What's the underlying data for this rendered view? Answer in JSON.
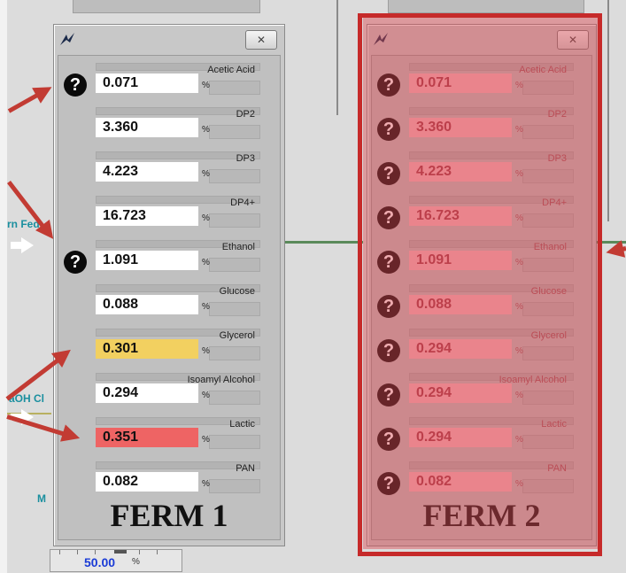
{
  "side_labels": {
    "feed": "rn Fed",
    "naoh": "aOH Cl",
    "m": "M"
  },
  "slider": {
    "value": "50.00",
    "unit": "%"
  },
  "ferm1": {
    "title": "FERM 1",
    "close_label": "✕",
    "rows": [
      {
        "label": "Acetic Acid",
        "value": "0.071",
        "unit": "%",
        "help": "?"
      },
      {
        "label": "DP2",
        "value": "3.360",
        "unit": "%"
      },
      {
        "label": "DP3",
        "value": "4.223",
        "unit": "%"
      },
      {
        "label": "DP4+",
        "value": "16.723",
        "unit": "%"
      },
      {
        "label": "Ethanol",
        "value": "1.091",
        "unit": "%",
        "help": "?"
      },
      {
        "label": "Glucose",
        "value": "0.088",
        "unit": "%"
      },
      {
        "label": "Glycerol",
        "value": "0.301",
        "unit": "%",
        "highlight": "#f2d060"
      },
      {
        "label": "Isoamyl Alcohol",
        "value": "0.294",
        "unit": "%"
      },
      {
        "label": "Lactic",
        "value": "0.351",
        "unit": "%",
        "highlight": "#ee6464"
      },
      {
        "label": "PAN",
        "value": "0.082",
        "unit": "%"
      }
    ]
  },
  "ferm2": {
    "title": "FERM 2",
    "close_label": "✕",
    "rows": [
      {
        "label": "Acetic Acid",
        "value": "0.071",
        "unit": "%",
        "help": "?"
      },
      {
        "label": "DP2",
        "value": "3.360",
        "unit": "%",
        "help": "?"
      },
      {
        "label": "DP3",
        "value": "4.223",
        "unit": "%",
        "help": "?"
      },
      {
        "label": "DP4+",
        "value": "16.723",
        "unit": "%",
        "help": "?"
      },
      {
        "label": "Ethanol",
        "value": "1.091",
        "unit": "%",
        "help": "?"
      },
      {
        "label": "Glucose",
        "value": "0.088",
        "unit": "%",
        "help": "?"
      },
      {
        "label": "Glycerol",
        "value": "0.294",
        "unit": "%",
        "help": "?"
      },
      {
        "label": "Isoamyl Alcohol",
        "value": "0.294",
        "unit": "%",
        "help": "?"
      },
      {
        "label": "Lactic",
        "value": "0.294",
        "unit": "%",
        "help": "?"
      },
      {
        "label": "PAN",
        "value": "0.082",
        "unit": "%",
        "help": "?"
      }
    ]
  },
  "colors": {
    "annotation_red": "#c23b33",
    "frame_red": "#c62a2a",
    "pipe_green": "#5a8a5a",
    "label_teal": "#1a8f9f"
  }
}
